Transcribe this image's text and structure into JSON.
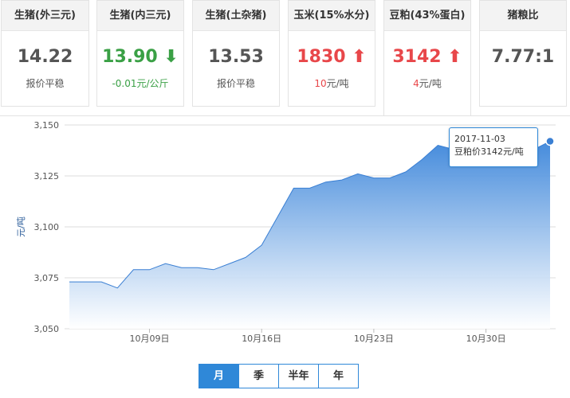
{
  "cards": [
    {
      "title": "生猪(外三元)",
      "value": "14.22",
      "sub_value": "",
      "sub_text": "报价平稳",
      "trend": "flat"
    },
    {
      "title": "生猪(内三元)",
      "value": "13.90",
      "sub_value": "-0.01",
      "sub_text": "元/公斤",
      "trend": "down"
    },
    {
      "title": "生猪(土杂猪)",
      "value": "13.53",
      "sub_value": "",
      "sub_text": "报价平稳",
      "trend": "flat"
    },
    {
      "title": "玉米(15%水分)",
      "value": "1830",
      "sub_value": "10",
      "sub_text": "元/吨",
      "trend": "up"
    },
    {
      "title": "豆粕(43%蛋白)",
      "value": "3142",
      "sub_value": "4",
      "sub_text": "元/吨",
      "trend": "up"
    },
    {
      "title": "猪粮比",
      "value": "7.77:1",
      "sub_value": "",
      "sub_text": "",
      "trend": "flat"
    }
  ],
  "colors": {
    "accent": "#2f88d8",
    "up": "#e8474a",
    "down": "#3aa045",
    "area_top": "#4a8fdc",
    "area_bottom": "#ffffff"
  },
  "chart_data": {
    "type": "area",
    "ylabel": "元/吨",
    "ylim": [
      3050,
      3150
    ],
    "yticks": [
      3050,
      3075,
      3100,
      3125,
      3150
    ],
    "ytick_labels": [
      "3,050",
      "3,075",
      "3,100",
      "3,125",
      "3,150"
    ],
    "x_start": "2017-10-04",
    "x_end": "2017-11-03",
    "xticks": [
      "2017-10-09",
      "2017-10-16",
      "2017-10-23",
      "2017-10-30"
    ],
    "xtick_labels": [
      "10月09日",
      "10月16日",
      "10月23日",
      "10月30日"
    ],
    "series": [
      {
        "name": "豆粕价",
        "points": [
          [
            "2017-10-04",
            3073
          ],
          [
            "2017-10-05",
            3073
          ],
          [
            "2017-10-06",
            3073
          ],
          [
            "2017-10-07",
            3070
          ],
          [
            "2017-10-08",
            3079
          ],
          [
            "2017-10-09",
            3079
          ],
          [
            "2017-10-10",
            3082
          ],
          [
            "2017-10-11",
            3080
          ],
          [
            "2017-10-12",
            3080
          ],
          [
            "2017-10-13",
            3079
          ],
          [
            "2017-10-14",
            3082
          ],
          [
            "2017-10-15",
            3085
          ],
          [
            "2017-10-16",
            3091
          ],
          [
            "2017-10-17",
            3105
          ],
          [
            "2017-10-18",
            3119
          ],
          [
            "2017-10-19",
            3119
          ],
          [
            "2017-10-20",
            3122
          ],
          [
            "2017-10-21",
            3123
          ],
          [
            "2017-10-22",
            3126
          ],
          [
            "2017-10-23",
            3124
          ],
          [
            "2017-10-24",
            3124
          ],
          [
            "2017-10-25",
            3127
          ],
          [
            "2017-10-26",
            3133
          ],
          [
            "2017-10-27",
            3140
          ],
          [
            "2017-10-28",
            3138
          ],
          [
            "2017-10-29",
            3138
          ],
          [
            "2017-10-30",
            3138
          ],
          [
            "2017-10-31",
            3140
          ],
          [
            "2017-11-01",
            3141
          ],
          [
            "2017-11-02",
            3138
          ],
          [
            "2017-11-03",
            3142
          ]
        ]
      }
    ],
    "tooltip": {
      "date": "2017-11-03",
      "text": "豆粕价3142元/吨"
    }
  },
  "tabs": [
    {
      "label": "月",
      "active": true
    },
    {
      "label": "季",
      "active": false
    },
    {
      "label": "半年",
      "active": false
    },
    {
      "label": "年",
      "active": false
    }
  ]
}
